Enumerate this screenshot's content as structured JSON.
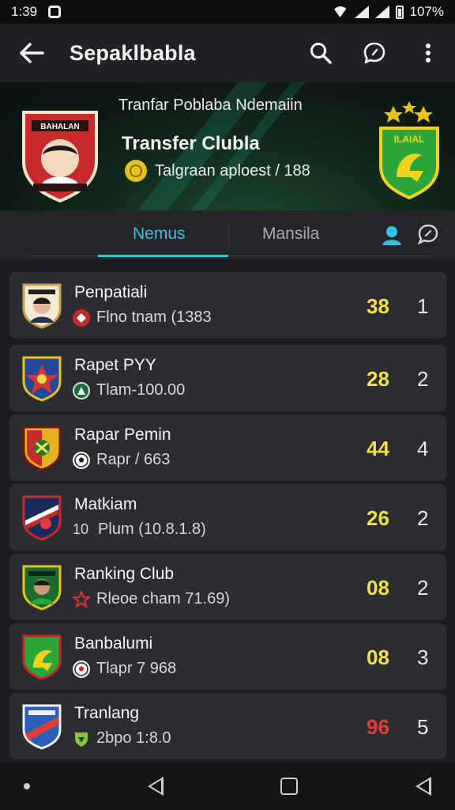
{
  "status_bar": {
    "time": "1:39",
    "battery": "107%"
  },
  "app_bar": {
    "title": "Sepaklbabla"
  },
  "hero": {
    "pre_title": "Tranfar Poblaba Ndemaiin",
    "title": "Transfer Clubla",
    "subtitle": "Talgraan aploest / 188",
    "right_crest_text": "ILAIAL"
  },
  "tabs": [
    {
      "label": "Nemus",
      "active": true
    },
    {
      "label": "Mansila",
      "active": false
    }
  ],
  "clubs": [
    {
      "name": "Penpatiali",
      "meta": "Flno tnam (1383",
      "score": "38",
      "rank": "1",
      "score_color": "#f2e14a",
      "crest": "photo-crest",
      "mini": "red-badge"
    },
    {
      "name": "Rapet PYY",
      "meta": "Tlam-100.00",
      "score": "28",
      "rank": "2",
      "score_color": "#f2e14a",
      "crest": "blue-shield",
      "mini": "green-badge"
    },
    {
      "name": "Rapar Pemin",
      "meta": "Rapr / 663",
      "score": "44",
      "rank": "4",
      "score_color": "#f2e14a",
      "crest": "red-yellow-shield",
      "mini": "ball"
    },
    {
      "name": "Matkiam",
      "meta": "Plum (10.8.1.8)",
      "meta_prefix": "10",
      "score": "26",
      "rank": "2",
      "score_color": "#f2e14a",
      "crest": "navy-red-shield",
      "mini": "none"
    },
    {
      "name": "Ranking Club",
      "meta": "Rleoe cham 71.69)",
      "score": "08",
      "rank": "2",
      "score_color": "#f2e14a",
      "crest": "green-photo-crest",
      "mini": "red-star"
    },
    {
      "name": "Banbalumi",
      "meta": "Tlapr 7 968",
      "score": "08",
      "rank": "3",
      "score_color": "#f2e14a",
      "crest": "green-red-shield",
      "mini": "ball"
    },
    {
      "name": "Tranlang",
      "meta": "2bpo 1:8.0",
      "score": "96",
      "rank": "5",
      "score_color": "#e23b3b",
      "crest": "blue-red-shield",
      "mini": "green-shield"
    }
  ],
  "colors": {
    "accent": "#39c0dc",
    "card": "#2b2d31",
    "score_yellow": "#f2e14a",
    "score_red": "#e23b3b"
  }
}
